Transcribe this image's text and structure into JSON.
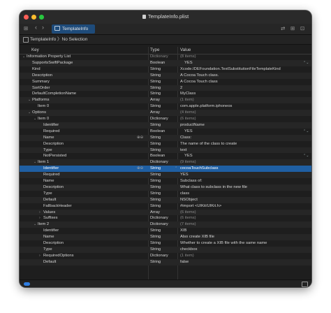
{
  "window": {
    "title": "TemplateInfo.plist",
    "traffic_lights": {
      "close": "#ff5f57",
      "minimize": "#febc2e",
      "zoom": "#28c840"
    }
  },
  "tabbar": {
    "grid_icon": "⊞",
    "back_icon": "‹",
    "forward_icon": "›",
    "tab_label": "TemplateInfo",
    "right_icons": [
      "⇄",
      "⊞",
      "⊡"
    ]
  },
  "jumpbar": {
    "path": "TemplateInfo 〉No Selection"
  },
  "columns": {
    "key": "Key",
    "type": "Type",
    "value": "Value"
  },
  "rows": [
    {
      "indent": 0,
      "disc": "⌄",
      "key": "Information Property List",
      "type": "Dictionary",
      "value": "(8 items)",
      "dimtype": true,
      "dimval": true
    },
    {
      "indent": 1,
      "key": "SupportsSwiftPackage",
      "type": "Boolean",
      "value": "YES",
      "stepper": true
    },
    {
      "indent": 1,
      "key": "Kind",
      "type": "String",
      "value": "Xcode.IDEFoundation.TextSubstitutionFileTemplateKind"
    },
    {
      "indent": 1,
      "key": "Description",
      "type": "String",
      "value": "A Cocoa Touch class."
    },
    {
      "indent": 1,
      "key": "Summary",
      "type": "String",
      "value": "A Cocoa Touch class"
    },
    {
      "indent": 1,
      "key": "SortOrder",
      "type": "String",
      "value": "2"
    },
    {
      "indent": 1,
      "key": "DefaultCompletionName",
      "type": "String",
      "value": "MyClass"
    },
    {
      "indent": 1,
      "disc": "⌄",
      "key": "Platforms",
      "type": "Array",
      "value": "(1 item)",
      "dimval": true
    },
    {
      "indent": 2,
      "key": "Item 0",
      "type": "String",
      "value": "com.apple.platform.iphoneos"
    },
    {
      "indent": 1,
      "disc": "⌄",
      "key": "Options",
      "type": "Array",
      "value": "(4 items)",
      "dimval": true
    },
    {
      "indent": 2,
      "disc": "⌄",
      "key": "Item 0",
      "type": "Dictionary",
      "value": "(6 items)",
      "dimval": true
    },
    {
      "indent": 3,
      "key": "Identifier",
      "type": "String",
      "value": "productName"
    },
    {
      "indent": 3,
      "key": "Required",
      "type": "Boolean",
      "value": "YES",
      "stepper": true
    },
    {
      "indent": 3,
      "key": "Name",
      "type": "String",
      "value": "Class:",
      "addrem": true
    },
    {
      "indent": 3,
      "key": "Description",
      "type": "String",
      "value": "The name of the class to create"
    },
    {
      "indent": 3,
      "key": "Type",
      "type": "String",
      "value": "text"
    },
    {
      "indent": 3,
      "key": "NotPersisted",
      "type": "Boolean",
      "value": "YES",
      "stepper": true
    },
    {
      "indent": 2,
      "disc": "⌄",
      "key": "Item 1",
      "type": "Dictionary",
      "value": "(9 items)",
      "dimval": true
    },
    {
      "indent": 3,
      "key": "Identifier",
      "type": "String",
      "value": "cocoaTouchSubclass",
      "selected": true,
      "addrem": true,
      "updown": true
    },
    {
      "indent": 3,
      "key": "Required",
      "type": "String",
      "value": "YES"
    },
    {
      "indent": 3,
      "key": "Name",
      "type": "String",
      "value": "Subclass of:"
    },
    {
      "indent": 3,
      "key": "Description",
      "type": "String",
      "value": "What class to subclass in the new file"
    },
    {
      "indent": 3,
      "key": "Type",
      "type": "String",
      "value": "class"
    },
    {
      "indent": 3,
      "key": "Default",
      "type": "String",
      "value": "NSObject"
    },
    {
      "indent": 3,
      "key": "FallbackHeader",
      "type": "String",
      "value": "#import <UIKit/UIKit.h>"
    },
    {
      "indent": 3,
      "disc": "›",
      "key": "Values",
      "type": "Array",
      "value": "(6 items)",
      "dimval": true
    },
    {
      "indent": 3,
      "disc": "›",
      "key": "Suffixes",
      "type": "Dictionary",
      "value": "(6 items)",
      "dimval": true
    },
    {
      "indent": 2,
      "disc": "⌄",
      "key": "Item 2",
      "type": "Dictionary",
      "value": "(7 items)",
      "dimval": true
    },
    {
      "indent": 3,
      "key": "Identifier",
      "type": "String",
      "value": "XIB"
    },
    {
      "indent": 3,
      "key": "Name",
      "type": "String",
      "value": "Also create XIB file"
    },
    {
      "indent": 3,
      "key": "Description",
      "type": "String",
      "value": "Whether to create a XIB file with the same name"
    },
    {
      "indent": 3,
      "key": "Type",
      "type": "String",
      "value": "checkbox"
    },
    {
      "indent": 3,
      "disc": "›",
      "key": "RequiredOptions",
      "type": "Dictionary",
      "value": "(1 item)",
      "dimval": true
    },
    {
      "indent": 3,
      "key": "Default",
      "type": "String",
      "value": "false"
    }
  ],
  "glyphs": {
    "stepper": "⌃⌄",
    "addrem": "⊕⊖",
    "updown": "⌃"
  },
  "colors": {
    "selection": "#1f5fa3",
    "toggle": "#2f7de1",
    "tab": "#1e4b7a"
  }
}
